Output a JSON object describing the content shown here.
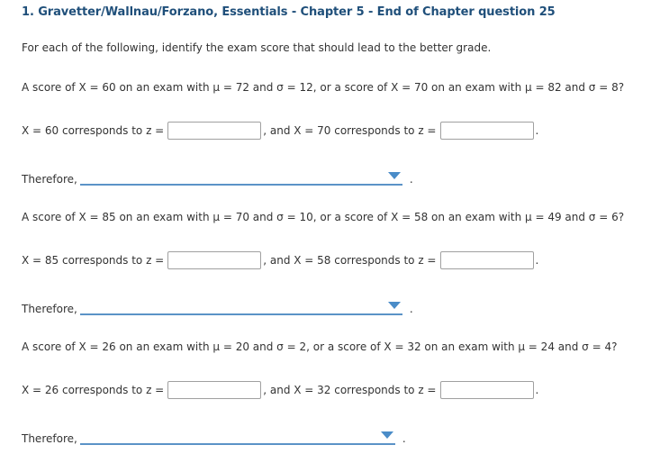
{
  "title": "1. Gravetter/Wallnau/Forzano, Essentials - Chapter 5 - End of Chapter question 25",
  "intro": "For each of the following, identify the exam score that should lead to the better grade.",
  "parts": [
    {
      "question": "A score of X = 60 on an exam with μ = 72 and σ = 12, or a score of X = 70 on an exam with μ = 82 and σ = 8?",
      "z_label_1": "X = 60 corresponds to z =",
      "z_value_1": "",
      "z_label_2": ", and X = 70 corresponds to z =",
      "z_value_2": "",
      "end_punct": ".",
      "therefore_label": "Therefore,",
      "selected_option": ""
    },
    {
      "question": "A score of X = 85 on an exam with μ = 70 and σ = 10, or a score of X = 58 on an exam with μ = 49 and σ = 6?",
      "z_label_1": "X = 85 corresponds to z =",
      "z_value_1": "",
      "z_label_2": ", and X = 58 corresponds to z =",
      "z_value_2": "",
      "end_punct": ".",
      "therefore_label": "Therefore,",
      "selected_option": ""
    },
    {
      "question": "A score of X = 26 on an exam with μ = 20 and σ = 2, or a score of X = 32 on an exam with μ = 24 and σ = 4?",
      "z_label_1": "X = 26 corresponds to z =",
      "z_value_1": "",
      "z_label_2": ", and X = 32 corresponds to z =",
      "z_value_2": "",
      "end_punct": ".",
      "therefore_label": "Therefore,",
      "selected_option": ""
    }
  ],
  "icons": {
    "dropdown": "chevron-down-triangle-icon"
  },
  "colors": {
    "title": "#1f4f7a",
    "dropdown_accent": "#5b93c7",
    "text": "#333333"
  }
}
